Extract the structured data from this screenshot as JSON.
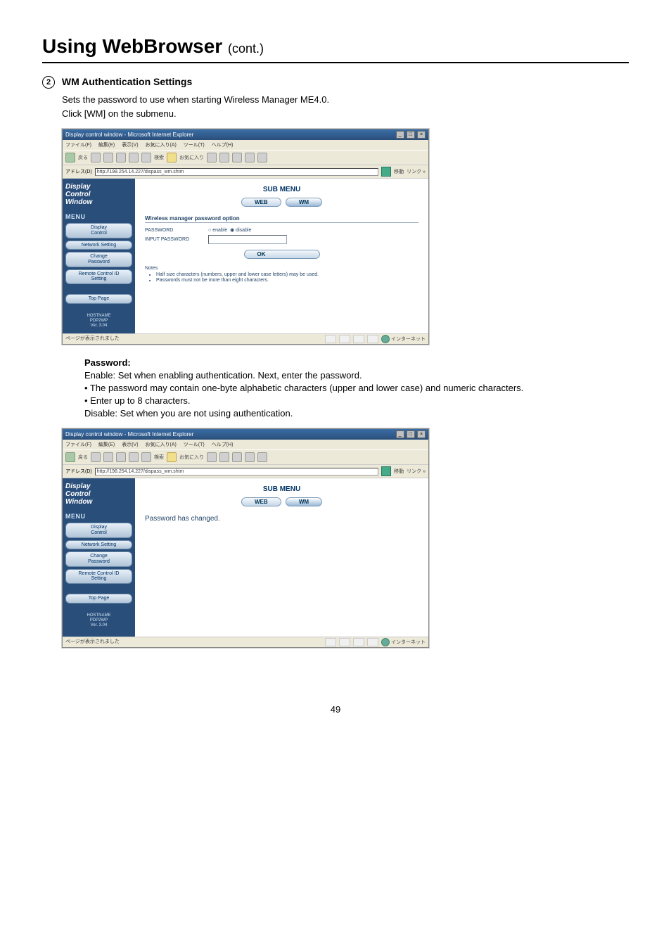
{
  "page": {
    "title_main": "Using WebBrowser",
    "title_cont": "(cont.)",
    "page_number": "49"
  },
  "section": {
    "marker": "2",
    "heading": "WM Authentication Settings",
    "desc_line1": "Sets the password to use when starting Wireless Manager ME4.0.",
    "desc_line2": "Click [WM] on the submenu."
  },
  "password_block": {
    "label": "Password:",
    "enable_line": "Enable:  Set when enabling authentication. Next, enter the password.",
    "bullet1": "• The password may contain one-byte alphabetic characters (upper and lower case) and numeric characters.",
    "bullet2": "• Enter up to 8 characters.",
    "disable_line": "Disable: Set when you are not using authentication."
  },
  "browser": {
    "title": "Display control window - Microsoft Internet Explorer",
    "menu": {
      "file": "ファイル(F)",
      "edit": "編集(E)",
      "view": "表示(V)",
      "fav": "お気に入り(A)",
      "tool": "ツール(T)",
      "help": "ヘルプ(H)"
    },
    "toolbar": {
      "back": "戻る",
      "search": "検索",
      "fav": "お気に入り"
    },
    "addr_label": "アドレス(D)",
    "url": "http://198.254.14.227/dispass_wm.shtm",
    "go": "移動",
    "links": "リンク »",
    "status_left_loaded": "ページが表示されました",
    "status_right": "インターネット"
  },
  "dcw": {
    "brand_l1": "Display",
    "brand_l2": "Control",
    "brand_l3": "Window",
    "menu_heading": "MENU",
    "btn_display_control": "Display\nControl",
    "btn_network": "Network Setting",
    "btn_change_pw": "Change\nPassword",
    "btn_remote_id": "Remote Control ID\nSetting",
    "btn_top": "Top Page",
    "host_l1": "HOSTNAME",
    "host_l2": "PDP2WP",
    "host_l3": "Ver. 3.04",
    "submenu_title": "SUB MENU",
    "tab_web": "WEB",
    "tab_wm": "WM"
  },
  "screen1": {
    "opt_heading": "Wireless manager password option",
    "row_pw_label": "PASSWORD",
    "row_pw_enable": "enable",
    "row_pw_disable": "disable",
    "row_input_label": "INPUT PASSWORD",
    "btn_ok": "OK",
    "notes_label": "Notes",
    "note1": "Half size characters (numbers, upper and lower case letters) may be used.",
    "note2": "Passwords must not be more than eight characters."
  },
  "screen2": {
    "msg": "Password has changed."
  }
}
